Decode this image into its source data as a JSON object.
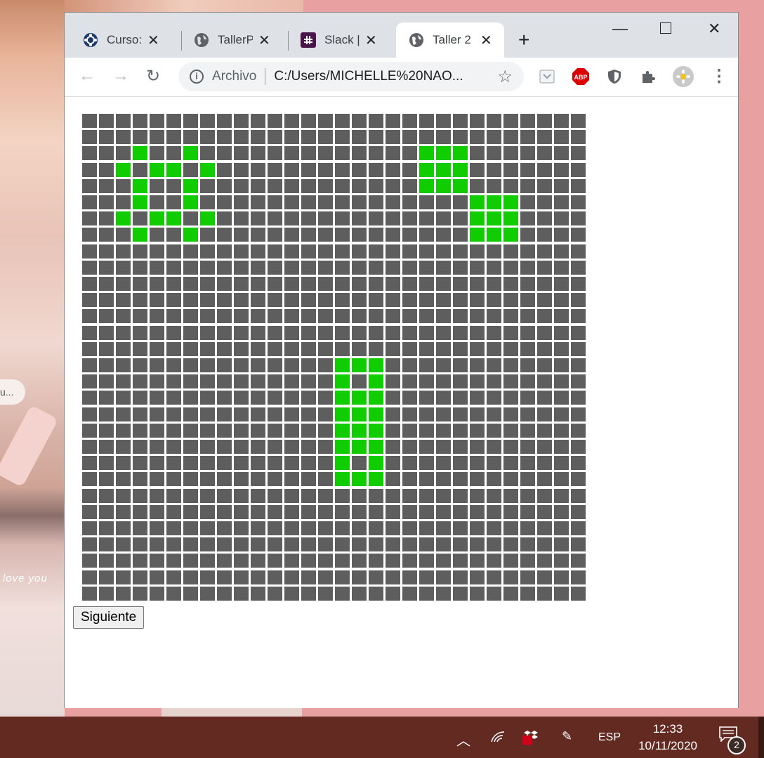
{
  "browser": {
    "tabs": [
      {
        "title": "Curso: ",
        "icon": "snowflake-icon"
      },
      {
        "title": "TallerPr",
        "icon": "globe-icon"
      },
      {
        "title": "Slack | ",
        "icon": "slack-icon"
      },
      {
        "title": "Taller 2",
        "icon": "globe-icon",
        "active": true
      }
    ],
    "address": {
      "scheme": "Archivo",
      "url": "C:/Users/MICHELLE%20NAO..."
    },
    "extensions": [
      "pocket-icon",
      "adblock-icon",
      "shield-icon",
      "puzzle-icon",
      "profile-avatar"
    ],
    "colors": {
      "dead_cell": "#5e5e5e",
      "alive_cell": "#11cc00"
    }
  },
  "game": {
    "cols": 30,
    "rows": 30,
    "alive": [
      [
        2,
        3
      ],
      [
        2,
        6
      ],
      [
        2,
        20
      ],
      [
        2,
        21
      ],
      [
        2,
        22
      ],
      [
        3,
        2
      ],
      [
        3,
        4
      ],
      [
        3,
        5
      ],
      [
        3,
        7
      ],
      [
        3,
        20
      ],
      [
        3,
        21
      ],
      [
        3,
        22
      ],
      [
        4,
        3
      ],
      [
        4,
        6
      ],
      [
        4,
        20
      ],
      [
        4,
        21
      ],
      [
        4,
        22
      ],
      [
        5,
        3
      ],
      [
        5,
        6
      ],
      [
        5,
        23
      ],
      [
        5,
        24
      ],
      [
        5,
        25
      ],
      [
        6,
        2
      ],
      [
        6,
        4
      ],
      [
        6,
        5
      ],
      [
        6,
        7
      ],
      [
        6,
        23
      ],
      [
        6,
        24
      ],
      [
        6,
        25
      ],
      [
        7,
        3
      ],
      [
        7,
        6
      ],
      [
        7,
        23
      ],
      [
        7,
        24
      ],
      [
        7,
        25
      ],
      [
        15,
        15
      ],
      [
        15,
        16
      ],
      [
        15,
        17
      ],
      [
        16,
        15
      ],
      [
        16,
        17
      ],
      [
        17,
        15
      ],
      [
        17,
        16
      ],
      [
        17,
        17
      ],
      [
        18,
        15
      ],
      [
        18,
        16
      ],
      [
        18,
        17
      ],
      [
        19,
        15
      ],
      [
        19,
        16
      ],
      [
        19,
        17
      ],
      [
        20,
        15
      ],
      [
        20,
        16
      ],
      [
        20,
        17
      ],
      [
        21,
        15
      ],
      [
        21,
        17
      ],
      [
        22,
        15
      ],
      [
        22,
        16
      ],
      [
        22,
        17
      ]
    ],
    "next_label": "Siguiente"
  },
  "taskbar": {
    "language": "ESP",
    "time": "12:33",
    "date": "10/11/2020",
    "notifications": "2",
    "background": "#632a21"
  }
}
